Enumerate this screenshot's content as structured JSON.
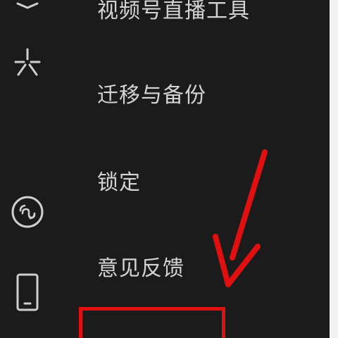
{
  "menu": {
    "items": [
      {
        "label": "视频号直播工具"
      },
      {
        "label": "迁移与备份"
      },
      {
        "label": "锁定"
      },
      {
        "label": "意见反馈"
      }
    ]
  },
  "sidebar": {
    "icons": [
      "settings-sparkle-icon",
      "mini-program-icon",
      "phone-icon"
    ]
  },
  "annotation": {
    "color": "#e01010"
  }
}
